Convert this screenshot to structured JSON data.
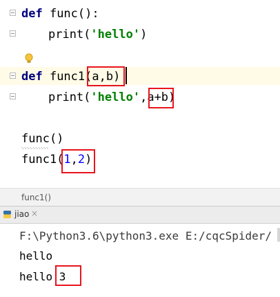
{
  "editor": {
    "line1": {
      "keyword": "def",
      "rest": " func():"
    },
    "line2": {
      "pre": "print(",
      "string": "'hello'",
      "post": ")"
    },
    "line4": {
      "keyword": "def",
      "name": " func1",
      "params": "(a,b)"
    },
    "line5": {
      "pre": "print(",
      "string": "'hello'",
      "comma": ",",
      "expr": "a+b",
      "post": ")"
    },
    "line7": {
      "text": "func()"
    },
    "line8": {
      "name": "func1(",
      "arg1": "1",
      "comma": ",",
      "arg2": "2",
      "post": ")"
    }
  },
  "breadcrumb": {
    "text": "func1()"
  },
  "run_panel": {
    "tab_label": "jiao",
    "close_glyph": "×",
    "console_lines": [
      "F:\\Python3.6\\python3.exe E:/cqcSpider/",
      "hello",
      "hello 3"
    ]
  },
  "colors": {
    "keyword": "#000080",
    "string": "#008000",
    "number": "#0000ff",
    "annotation_box": "#e8141d"
  }
}
